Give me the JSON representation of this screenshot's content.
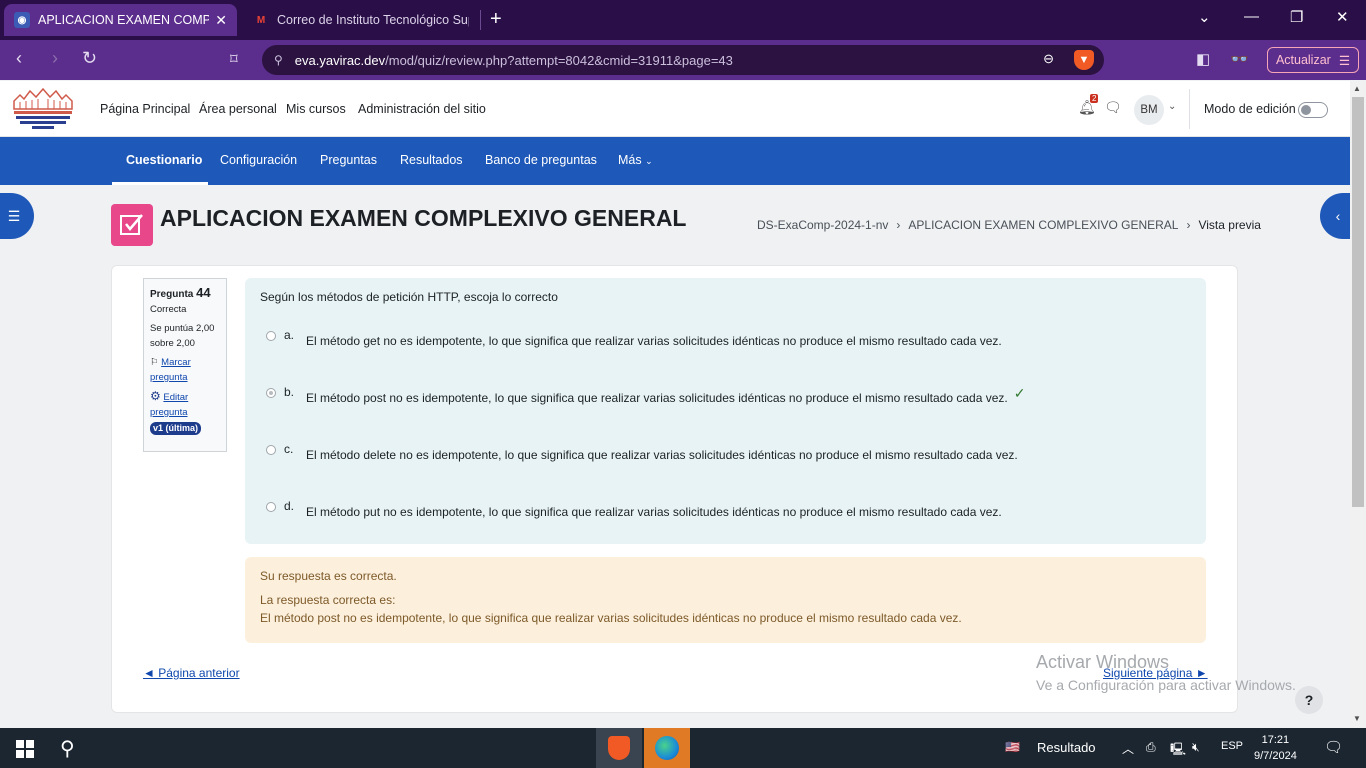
{
  "browser": {
    "tabs": [
      {
        "title": "APLICACION EXAMEN COMPLEXIVO GENERAL",
        "active": true
      },
      {
        "title": "Correo de Instituto Tecnológico Superior",
        "active": false
      }
    ],
    "url_host": "eva.yavirac.dev",
    "url_path": "/mod/quiz/review.php?attempt=8042&cmid=31911&page=43",
    "update_label": "Actualizar"
  },
  "nav": {
    "links": [
      "Página Principal",
      "Área personal",
      "Mis cursos",
      "Administración del sitio"
    ],
    "notification_count": "2",
    "avatar_initials": "BM",
    "edit_mode_label": "Modo de edición"
  },
  "secondary_nav": {
    "items": [
      "Cuestionario",
      "Configuración",
      "Preguntas",
      "Resultados",
      "Banco de preguntas",
      "Más"
    ]
  },
  "page": {
    "title": "APLICACION EXAMEN COMPLEXIVO GENERAL",
    "breadcrumb": [
      "DS-ExaComp-2024-1-nv",
      "APLICACION EXAMEN COMPLEXIVO GENERAL",
      "Vista previa"
    ]
  },
  "question_info": {
    "label": "Pregunta",
    "number": "44",
    "state": "Correcta",
    "score": "Se puntúa 2,00 sobre 2,00",
    "flag_label": "Marcar pregunta",
    "edit_label": "Editar pregunta",
    "version": "v1 (última)"
  },
  "question": {
    "text": "Según los métodos de petición HTTP, escoja lo correcto",
    "options": [
      {
        "letter": "a.",
        "text": "El método get no es idempotente, lo que significa que realizar varias solicitudes idénticas no produce el mismo resultado cada vez.",
        "selected": false
      },
      {
        "letter": "b.",
        "text": "El método post no es idempotente, lo que significa que realizar varias solicitudes idénticas no produce el mismo resultado cada vez.",
        "selected": true
      },
      {
        "letter": "c.",
        "text": "El método delete no es idempotente, lo que significa que realizar varias solicitudes idénticas no produce el mismo resultado cada vez.",
        "selected": false
      },
      {
        "letter": "d.",
        "text": "El método put no es idempotente, lo que significa que realizar varias solicitudes idénticas no produce el mismo resultado cada vez.",
        "selected": false
      }
    ]
  },
  "feedback": {
    "result": "Su respuesta es correcta.",
    "correct_label": "La respuesta correcta es:",
    "correct_answer": "El método post no es idempotente, lo que significa que realizar varias solicitudes idénticas no produce el mismo resultado cada vez."
  },
  "pager": {
    "prev": "◄ Página anterior",
    "next": "Siguiente página ►"
  },
  "watermark": {
    "line1": "Activar Windows",
    "line2": "Ve a Configuración para activar Windows."
  },
  "help_label": "?",
  "taskbar": {
    "weather_label": "Resultado",
    "language": "ESP",
    "time": "17:21",
    "date": "9/7/2024"
  },
  "colors": {
    "brand_blue": "#1e58b8",
    "browser_purple": "#5b2d8c",
    "quiz_icon_pink": "#e8478a",
    "correct_green": "#357a32"
  }
}
